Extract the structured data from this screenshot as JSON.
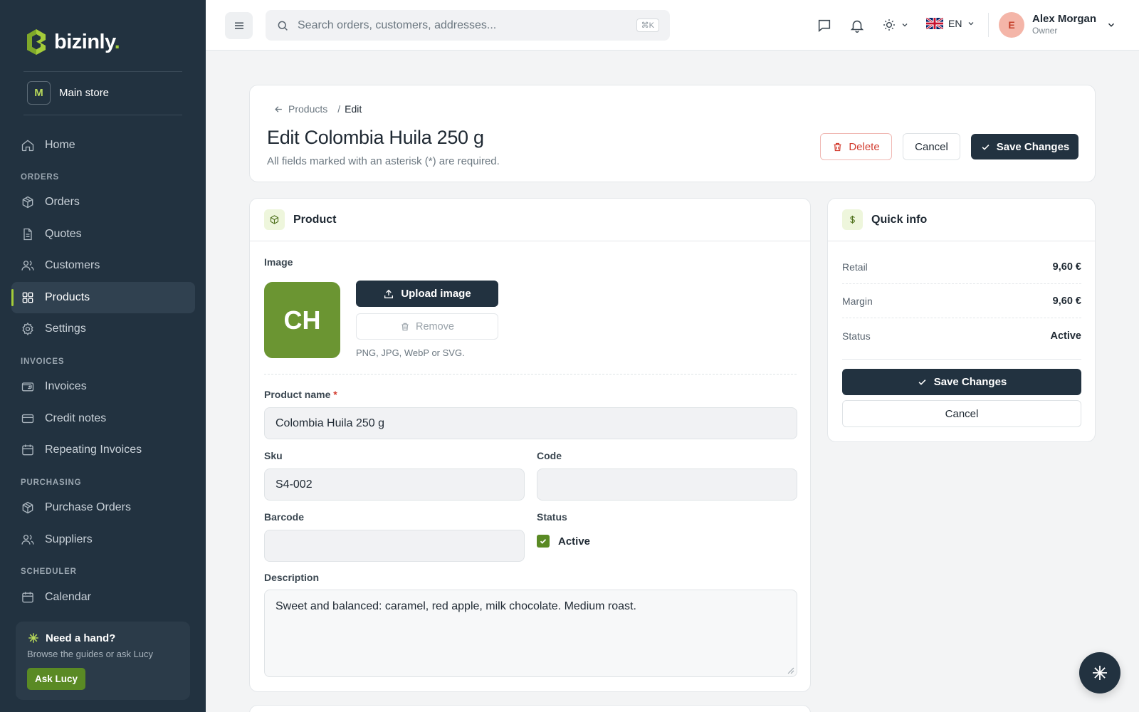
{
  "brand": {
    "name": "bizinly",
    "dot": "."
  },
  "store": {
    "initial": "M",
    "name": "Main store"
  },
  "nav": {
    "home": "Home",
    "sections": {
      "orders": "ORDERS",
      "invoices": "INVOICES",
      "purchasing": "PURCHASING",
      "scheduler": "SCHEDULER"
    },
    "orders": "Orders",
    "quotes": "Quotes",
    "customers": "Customers",
    "products": "Products",
    "settings": "Settings",
    "invoices": "Invoices",
    "credit_notes": "Credit notes",
    "repeating_invoices": "Repeating Invoices",
    "purchase_orders": "Purchase Orders",
    "suppliers": "Suppliers",
    "calendar": "Calendar",
    "active_item": "Products"
  },
  "help": {
    "title": "Need a hand?",
    "subtitle": "Browse the guides or ask Lucy",
    "button": "Ask Lucy"
  },
  "topbar": {
    "search_placeholder": "Search orders, customers, addresses...",
    "shortcut": "⌘K",
    "language": "EN",
    "user": {
      "initial": "E",
      "name": "Alex Morgan",
      "role": "Owner"
    }
  },
  "header": {
    "breadcrumb_parent": "Products",
    "breadcrumb_sep": "/",
    "breadcrumb_current": "Edit",
    "title": "Edit Colombia Huila 250 g",
    "subtitle": "All fields marked with an asterisk (*) are required.",
    "delete_label": "Delete",
    "cancel_label": "Cancel",
    "save_label": "Save Changes"
  },
  "product": {
    "section_title": "Product",
    "image_label": "Image",
    "image_initials": "CH",
    "upload_label": "Upload image",
    "remove_label": "Remove",
    "image_hint": "PNG, JPG, WebP or SVG.",
    "name_label": "Product name",
    "required_mark": "*",
    "name_value": "Colombia Huila 250 g",
    "sku_label": "Sku",
    "sku_value": "S4-002",
    "code_label": "Code",
    "code_value": "",
    "barcode_label": "Barcode",
    "barcode_value": "",
    "status_label": "Status",
    "status_checkbox_label": "Active",
    "status_checked": true,
    "description_label": "Description",
    "description_value": "Sweet and balanced: caramel, red apple, milk chocolate. Medium roast."
  },
  "quick_info": {
    "title": "Quick info",
    "rows": [
      {
        "key": "Retail",
        "value": "9,60 €"
      },
      {
        "key": "Margin",
        "value": "9,60 €"
      },
      {
        "key": "Status",
        "value": "Active"
      }
    ],
    "save_label": "Save Changes",
    "cancel_label": "Cancel"
  },
  "colors": {
    "sidebar": "#223240",
    "accent": "#a4cc3a",
    "primary_button": "#223240",
    "danger": "#d23b2e",
    "image_tile": "#6b9532"
  }
}
